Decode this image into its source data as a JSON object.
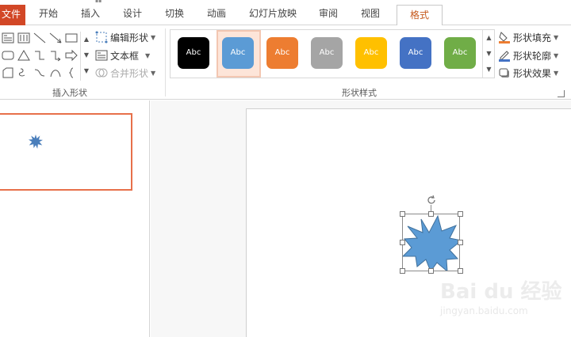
{
  "tabs": {
    "file": "文件",
    "home": "开始",
    "insert": "插入",
    "design": "设计",
    "transitions": "切换",
    "animations": "动画",
    "slideshow": "幻灯片放映",
    "review": "审阅",
    "view": "视图",
    "format": "格式"
  },
  "insert_shapes": {
    "group_label": "插入形状",
    "edit_shape": "编辑形状",
    "text_box": "文本框",
    "merge_shapes": "合并形状"
  },
  "shape_styles": {
    "group_label": "形状样式",
    "presets": [
      {
        "label": "Abc",
        "fill": "#000000",
        "text": "#ffffff"
      },
      {
        "label": "Abc",
        "fill": "#5b9bd5",
        "text": "#ffffff"
      },
      {
        "label": "Abc",
        "fill": "#ed7d31",
        "text": "#ffffff"
      },
      {
        "label": "Abc",
        "fill": "#a5a5a5",
        "text": "#ffffff"
      },
      {
        "label": "Abc",
        "fill": "#ffc000",
        "text": "#ffffff"
      },
      {
        "label": "Abc",
        "fill": "#4472c4",
        "text": "#ffffff"
      },
      {
        "label": "Abc",
        "fill": "#70ad47",
        "text": "#ffffff"
      }
    ],
    "fill": "形状填充",
    "outline": "形状轮廓",
    "effects": "形状效果"
  },
  "colors": {
    "file_tab": "#d24726",
    "accent": "#c65a1e",
    "thumb_border": "#e7704a",
    "shape_fill": "#5b9bd5"
  },
  "icons": {
    "fill": "paint-bucket-icon",
    "outline": "pen-outline-icon",
    "effects": "shape-effects-icon",
    "rotate": "rotate-handle-icon"
  },
  "watermark": {
    "main": "Bai du 经验",
    "sub": "jingyan.baidu.com"
  }
}
